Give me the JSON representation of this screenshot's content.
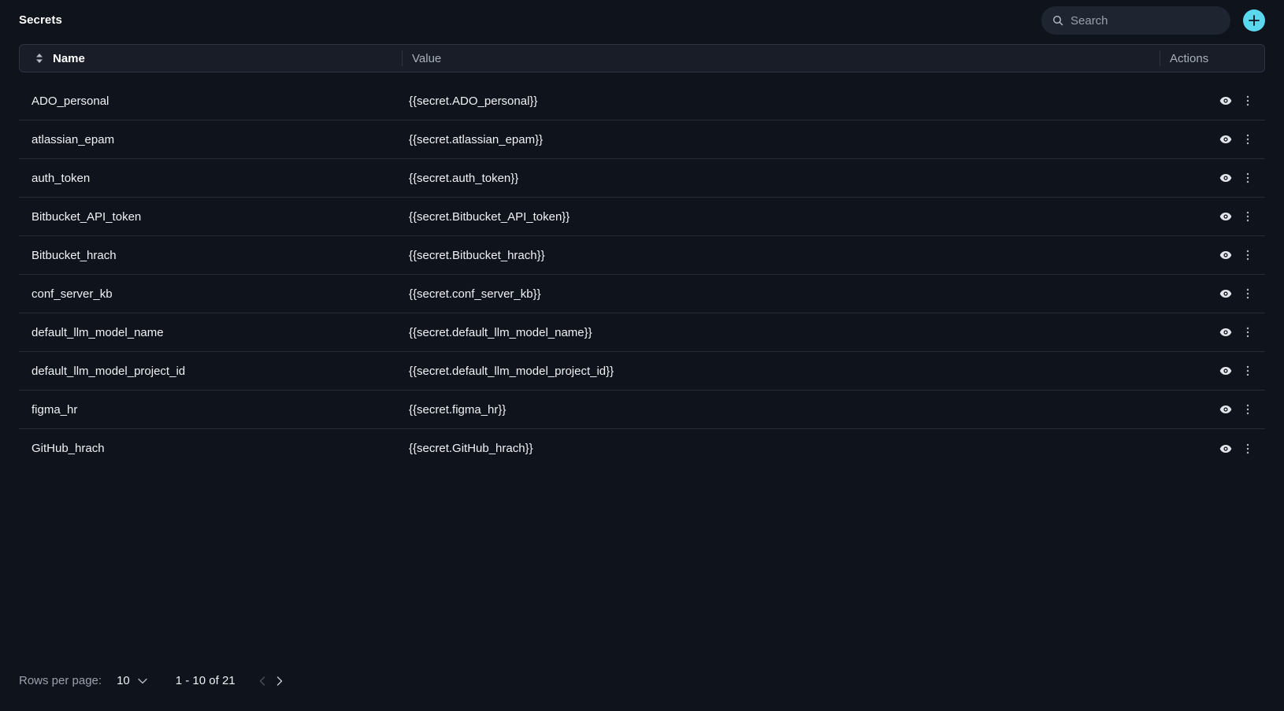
{
  "header": {
    "title": "Secrets",
    "search_placeholder": "Search",
    "search_value": "",
    "add_icon": "plus-icon"
  },
  "table": {
    "columns": {
      "name": "Name",
      "value": "Value",
      "actions": "Actions"
    },
    "rows": [
      {
        "name": "ADO_personal",
        "value": "{{secret.ADO_personal}}"
      },
      {
        "name": "atlassian_epam",
        "value": "{{secret.atlassian_epam}}"
      },
      {
        "name": "auth_token",
        "value": "{{secret.auth_token}}"
      },
      {
        "name": "Bitbucket_API_token",
        "value": "{{secret.Bitbucket_API_token}}"
      },
      {
        "name": "Bitbucket_hrach",
        "value": "{{secret.Bitbucket_hrach}}"
      },
      {
        "name": "conf_server_kb",
        "value": "{{secret.conf_server_kb}}"
      },
      {
        "name": "default_llm_model_name",
        "value": "{{secret.default_llm_model_name}}"
      },
      {
        "name": "default_llm_model_project_id",
        "value": "{{secret.default_llm_model_project_id}}"
      },
      {
        "name": "figma_hr",
        "value": "{{secret.figma_hr}}"
      },
      {
        "name": "GitHub_hrach",
        "value": "{{secret.GitHub_hrach}}"
      }
    ]
  },
  "pagination": {
    "rows_per_page_label": "Rows per page:",
    "rows_per_page_value": "10",
    "range_text": "1 - 10 of 21"
  },
  "colors": {
    "background": "#0f131c",
    "accent": "#5ad8ee",
    "header_bg": "#181d27",
    "border": "#2d3442",
    "text_muted": "#9aa1ad"
  }
}
